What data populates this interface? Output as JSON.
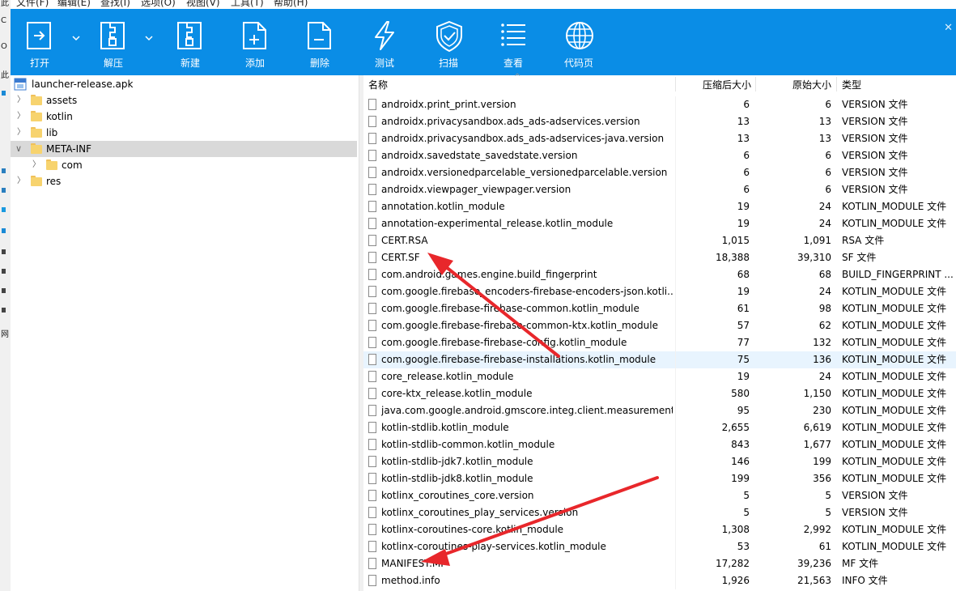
{
  "menu": [
    "文件(F)",
    "编辑(E)",
    "查找(I)",
    "选项(O)",
    "视图(V)",
    "工具(T)",
    "帮助(H)"
  ],
  "left_strip": [
    "此",
    "C",
    "O",
    "网"
  ],
  "toolbar": {
    "buttons": [
      {
        "label": "打开",
        "icon": "open-icon"
      },
      {
        "label": "解压",
        "icon": "extract-icon"
      },
      {
        "label": "新建",
        "icon": "new-archive-icon"
      },
      {
        "label": "添加",
        "icon": "add-file-icon"
      },
      {
        "label": "删除",
        "icon": "delete-file-icon"
      },
      {
        "label": "测试",
        "icon": "lightning-icon"
      },
      {
        "label": "扫描",
        "icon": "shield-check-icon"
      },
      {
        "label": "查看",
        "icon": "list-icon"
      },
      {
        "label": "代码页",
        "icon": "globe-icon"
      }
    ],
    "bg_color": "#0a8de6"
  },
  "tree": {
    "root": {
      "label": "launcher-release.apk",
      "icon": "apk-icon"
    },
    "nodes": [
      {
        "label": "assets",
        "expanded": false,
        "depth": 1
      },
      {
        "label": "kotlin",
        "expanded": false,
        "depth": 1
      },
      {
        "label": "lib",
        "expanded": false,
        "depth": 1
      },
      {
        "label": "META-INF",
        "expanded": true,
        "selected": true,
        "depth": 1
      },
      {
        "label": "com",
        "expanded": false,
        "depth": 2
      },
      {
        "label": "res",
        "expanded": false,
        "depth": 1
      }
    ]
  },
  "columns": {
    "name": "名称",
    "compressed": "压缩后大小",
    "original": "原始大小",
    "type": "类型"
  },
  "files": [
    {
      "name": "androidx.print_print.version",
      "compressed": "6",
      "original": "6",
      "type": "VERSION 文件"
    },
    {
      "name": "androidx.privacysandbox.ads_ads-adservices.version",
      "compressed": "13",
      "original": "13",
      "type": "VERSION 文件"
    },
    {
      "name": "androidx.privacysandbox.ads_ads-adservices-java.version",
      "compressed": "13",
      "original": "13",
      "type": "VERSION 文件"
    },
    {
      "name": "androidx.savedstate_savedstate.version",
      "compressed": "6",
      "original": "6",
      "type": "VERSION 文件"
    },
    {
      "name": "androidx.versionedparcelable_versionedparcelable.version",
      "compressed": "6",
      "original": "6",
      "type": "VERSION 文件"
    },
    {
      "name": "androidx.viewpager_viewpager.version",
      "compressed": "6",
      "original": "6",
      "type": "VERSION 文件"
    },
    {
      "name": "annotation.kotlin_module",
      "compressed": "19",
      "original": "24",
      "type": "KOTLIN_MODULE 文件"
    },
    {
      "name": "annotation-experimental_release.kotlin_module",
      "compressed": "19",
      "original": "24",
      "type": "KOTLIN_MODULE 文件"
    },
    {
      "name": "CERT.RSA",
      "compressed": "1,015",
      "original": "1,091",
      "type": "RSA 文件"
    },
    {
      "name": "CERT.SF",
      "compressed": "18,388",
      "original": "39,310",
      "type": "SF 文件"
    },
    {
      "name": "com.android.games.engine.build_fingerprint",
      "compressed": "68",
      "original": "68",
      "type": "BUILD_FINGERPRINT ..."
    },
    {
      "name": "com.google.firebase_encoders-firebase-encoders-json.kotli...",
      "compressed": "19",
      "original": "24",
      "type": "KOTLIN_MODULE 文件"
    },
    {
      "name": "com.google.firebase-firebase-common.kotlin_module",
      "compressed": "61",
      "original": "98",
      "type": "KOTLIN_MODULE 文件"
    },
    {
      "name": "com.google.firebase-firebase-common-ktx.kotlin_module",
      "compressed": "57",
      "original": "62",
      "type": "KOTLIN_MODULE 文件"
    },
    {
      "name": "com.google.firebase-firebase-config.kotlin_module",
      "compressed": "77",
      "original": "132",
      "type": "KOTLIN_MODULE 文件"
    },
    {
      "name": "com.google.firebase-firebase-installations.kotlin_module",
      "compressed": "75",
      "original": "136",
      "type": "KOTLIN_MODULE 文件",
      "selected": true
    },
    {
      "name": "core_release.kotlin_module",
      "compressed": "19",
      "original": "24",
      "type": "KOTLIN_MODULE 文件"
    },
    {
      "name": "core-ktx_release.kotlin_module",
      "compressed": "580",
      "original": "1,150",
      "type": "KOTLIN_MODULE 文件"
    },
    {
      "name": "java.com.google.android.gmscore.integ.client.measurement...",
      "compressed": "95",
      "original": "230",
      "type": "KOTLIN_MODULE 文件"
    },
    {
      "name": "kotlin-stdlib.kotlin_module",
      "compressed": "2,655",
      "original": "6,619",
      "type": "KOTLIN_MODULE 文件"
    },
    {
      "name": "kotlin-stdlib-common.kotlin_module",
      "compressed": "843",
      "original": "1,677",
      "type": "KOTLIN_MODULE 文件"
    },
    {
      "name": "kotlin-stdlib-jdk7.kotlin_module",
      "compressed": "146",
      "original": "199",
      "type": "KOTLIN_MODULE 文件"
    },
    {
      "name": "kotlin-stdlib-jdk8.kotlin_module",
      "compressed": "199",
      "original": "356",
      "type": "KOTLIN_MODULE 文件"
    },
    {
      "name": "kotlinx_coroutines_core.version",
      "compressed": "5",
      "original": "5",
      "type": "VERSION 文件"
    },
    {
      "name": "kotlinx_coroutines_play_services.version",
      "compressed": "5",
      "original": "5",
      "type": "VERSION 文件"
    },
    {
      "name": "kotlinx-coroutines-core.kotlin_module",
      "compressed": "1,308",
      "original": "2,992",
      "type": "KOTLIN_MODULE 文件"
    },
    {
      "name": "kotlinx-coroutines-play-services.kotlin_module",
      "compressed": "53",
      "original": "61",
      "type": "KOTLIN_MODULE 文件"
    },
    {
      "name": "MANIFEST.MF",
      "compressed": "17,282",
      "original": "39,236",
      "type": "MF 文件"
    },
    {
      "name": "method.info",
      "compressed": "1,926",
      "original": "21,563",
      "type": "INFO 文件"
    }
  ],
  "annotation_color": "#e8272b"
}
